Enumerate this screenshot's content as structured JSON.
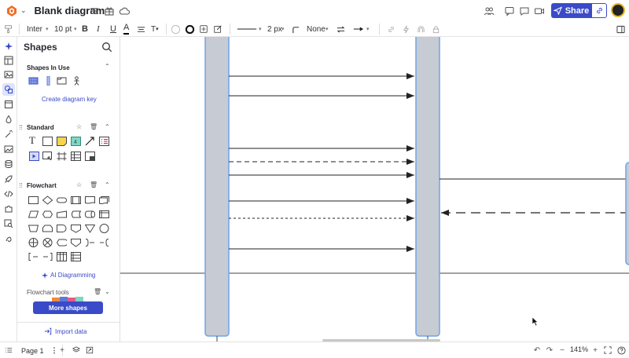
{
  "header": {
    "title": "Blank diagram",
    "share_label": "Share"
  },
  "format": {
    "font": "Inter",
    "font_size": "10 pt",
    "bold": "B",
    "italic": "I",
    "underline": "U",
    "text_color": "A",
    "text_style": "T",
    "line_width": "2 px",
    "line_end": "None"
  },
  "panel": {
    "title": "Shapes",
    "sections": {
      "in_use": "Shapes In Use",
      "standard": "Standard",
      "flowchart": "Flowchart",
      "flowchart_tools": "Flowchart tools"
    },
    "create_key": "Create diagram key",
    "ai_diagramming": "AI Diagramming",
    "more_shapes": "More shapes",
    "import_data": "Import data",
    "standard_text_shape": "T"
  },
  "footer": {
    "page": "Page 1",
    "zoom": "141%"
  },
  "colors": {
    "accent": "#3a4bc8",
    "lifeline_fill": "#c7cbd3",
    "lifeline_stroke": "#6ea4e8",
    "note_yellow": "#f7d54a",
    "note_teal": "#7fd6c4"
  }
}
